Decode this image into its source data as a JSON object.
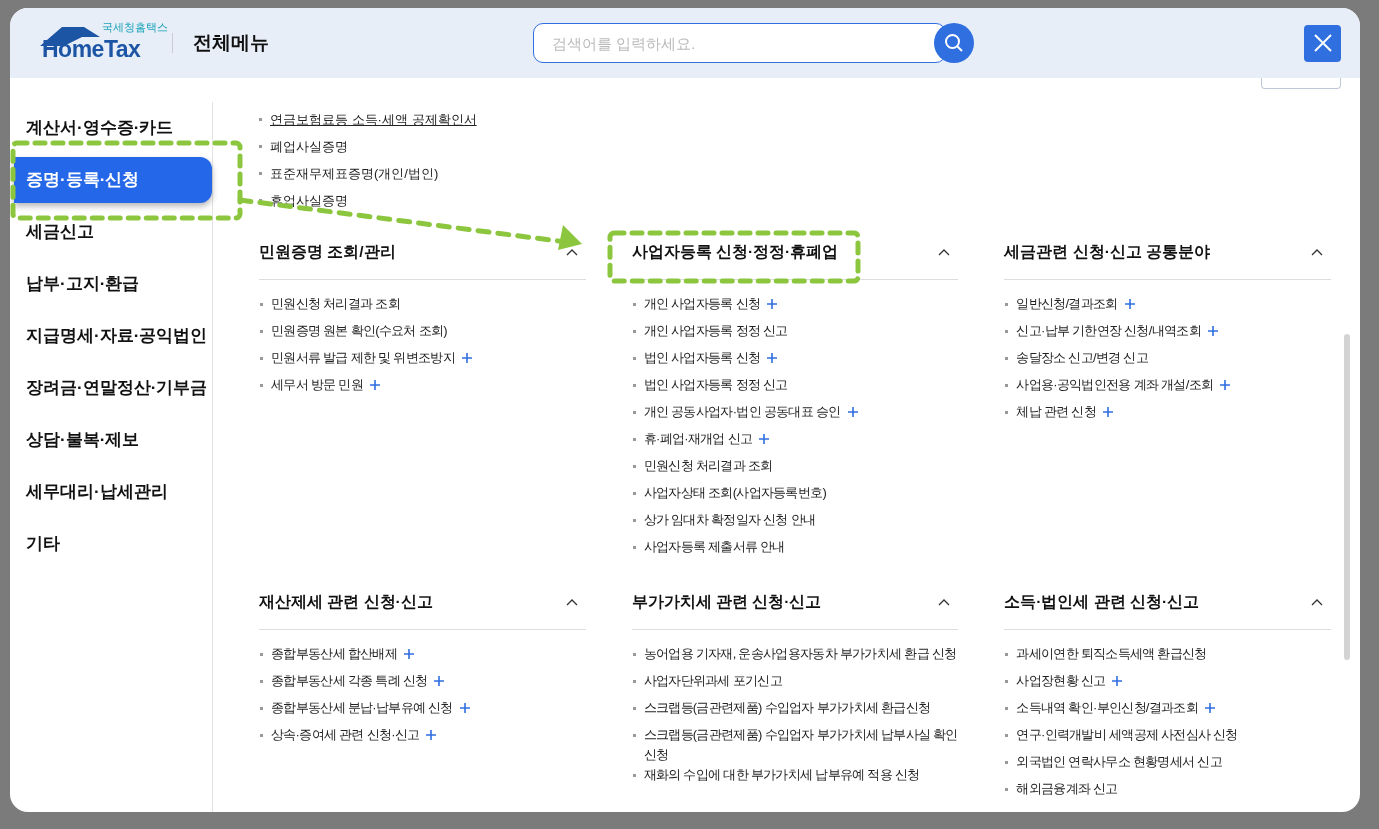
{
  "header": {
    "logo": {
      "caption": "국세청홈택스",
      "wordmark": "HomeTax"
    },
    "title": "전체메뉴",
    "search": {
      "placeholder": "검색어를 입력하세요."
    }
  },
  "sidebar": {
    "items": [
      {
        "label": "계산서·영수증·카드",
        "selected": false
      },
      {
        "label": "증명·등록·신청",
        "selected": true
      },
      {
        "label": "세금신고",
        "selected": false
      },
      {
        "label": "납부·고지·환급",
        "selected": false
      },
      {
        "label": "지급명세·자료·공익법인",
        "selected": false
      },
      {
        "label": "장려금·연말정산·기부금",
        "selected": false
      },
      {
        "label": "상담·불복·제보",
        "selected": false
      },
      {
        "label": "세무대리·납세관리",
        "selected": false
      },
      {
        "label": "기타",
        "selected": false
      }
    ]
  },
  "top_list": [
    {
      "label": "연금보험료등 소득·세액 공제확인서",
      "underlined": true
    },
    {
      "label": "폐업사실증명",
      "underlined": false
    },
    {
      "label": "표준재무제표증명(개인/법인)",
      "underlined": false
    },
    {
      "label": "휴업사실증명",
      "underlined": false
    }
  ],
  "sections": [
    {
      "title": "민원증명 조회/관리",
      "expanded": true,
      "items": [
        {
          "label": "민원신청 처리결과 조회",
          "plus": false
        },
        {
          "label": "민원증명 원본 확인(수요처 조회)",
          "plus": false
        },
        {
          "label": "민원서류 발급 제한 및 위변조방지",
          "plus": true
        },
        {
          "label": "세무서 방문 민원",
          "plus": true
        }
      ]
    },
    {
      "title": "사업자등록 신청·정정·휴폐업",
      "expanded": true,
      "items": [
        {
          "label": "개인 사업자등록 신청",
          "plus": true
        },
        {
          "label": "개인 사업자등록 정정 신고",
          "plus": false
        },
        {
          "label": "법인 사업자등록 신청",
          "plus": true
        },
        {
          "label": "법인 사업자등록 정정 신고",
          "plus": false
        },
        {
          "label": "개인 공동사업자·법인 공동대표 승인",
          "plus": true
        },
        {
          "label": "휴·폐업·재개업 신고",
          "plus": true
        },
        {
          "label": "민원신청 처리결과 조회",
          "plus": false
        },
        {
          "label": "사업자상태 조회(사업자등록번호)",
          "plus": false
        },
        {
          "label": "상가 임대차 확정일자 신청 안내",
          "plus": false
        },
        {
          "label": "사업자등록 제출서류 안내",
          "plus": false
        }
      ]
    },
    {
      "title": "세금관련 신청·신고 공통분야",
      "expanded": true,
      "items": [
        {
          "label": "일반신청/결과조회",
          "plus": true
        },
        {
          "label": "신고·납부 기한연장 신청/내역조회",
          "plus": true
        },
        {
          "label": "송달장소 신고/변경 신고",
          "plus": false
        },
        {
          "label": "사업용·공익법인전용 계좌 개설/조회",
          "plus": true
        },
        {
          "label": "체납 관련 신청",
          "plus": true
        }
      ]
    },
    {
      "title": "재산제세 관련 신청·신고",
      "expanded": true,
      "items": [
        {
          "label": "종합부동산세 합산배제",
          "plus": true
        },
        {
          "label": "종합부동산세 각종 특례 신청",
          "plus": true
        },
        {
          "label": "종합부동산세 분납·납부유예 신청",
          "plus": true
        },
        {
          "label": "상속·증여세 관련 신청·신고",
          "plus": true
        }
      ]
    },
    {
      "title": "부가가치세 관련 신청·신고",
      "expanded": true,
      "items": [
        {
          "label": "농어업용 기자재, 운송사업용자동차 부가가치세 환급 신청",
          "plus": false
        },
        {
          "label": "사업자단위과세 포기신고",
          "plus": false
        },
        {
          "label": "스크랩등(금관련제품) 수입업자 부가가치세 환급신청",
          "plus": false
        },
        {
          "label": "스크랩등(금관련제품) 수입업자 부가가치세 납부사실 확인신청",
          "plus": false
        },
        {
          "label": "재화의 수입에 대한 부가가치세 납부유예 적용 신청",
          "plus": false
        }
      ]
    },
    {
      "title": "소득·법인세 관련 신청·신고",
      "expanded": true,
      "items": [
        {
          "label": "과세이연한 퇴직소득세액 환급신청",
          "plus": false
        },
        {
          "label": "사업장현황 신고",
          "plus": true
        },
        {
          "label": "소득내역 확인·부인신청/결과조회",
          "plus": true
        },
        {
          "label": "연구·인력개발비 세액공제 사전심사 신청",
          "plus": false
        },
        {
          "label": "외국법인 연락사무소 현황명세서 신고",
          "plus": false
        },
        {
          "label": "해외금융계좌 신고",
          "plus": false
        }
      ]
    }
  ]
}
